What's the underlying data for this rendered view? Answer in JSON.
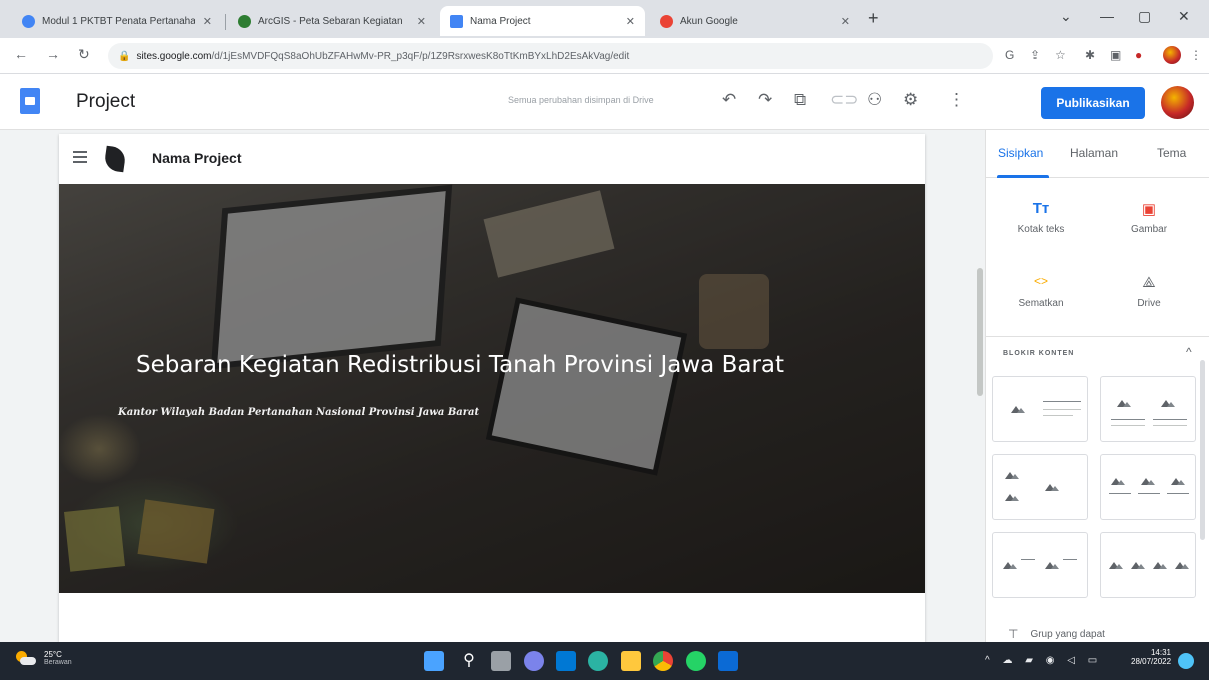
{
  "browser": {
    "tabs": [
      {
        "title": "Modul 1 PKTBT Penata Pertanahan",
        "favicon_color": "#4285f4"
      },
      {
        "title": "ArcGIS - Peta Sebaran Kegiatan",
        "favicon_color": "#2e7d32"
      },
      {
        "title": "Nama Project",
        "favicon_color": "#4285f4",
        "active": true
      },
      {
        "title": "Akun Google",
        "favicon_color": "#ea4335"
      }
    ],
    "new_tab_glyph": "+",
    "url_host": "sites.google.com",
    "url_path": "/d/1jEsMVDFQqS8aOhUbZFAHwMv-PR_p3qF/p/1Z9RsrxwesK8oTtKmBYxLhD2EsAkVag/edit"
  },
  "editor": {
    "doc_title": "Project",
    "save_status": "Semua perubahan disimpan di Drive",
    "publish_label": "Publikasikan",
    "header_icons": [
      "undo-icon",
      "redo-icon",
      "preview-icon",
      "link-icon",
      "share-icon",
      "settings-icon",
      "more-icon"
    ],
    "avatar_color": "#c62828"
  },
  "site": {
    "name": "Nama Project",
    "hero_title": "Sebaran Kegiatan Redistribusi Tanah Provinsi Jawa Barat",
    "hero_subtitle": "Kantor Wilayah Badan Pertanahan Nasional Provinsi Jawa Barat"
  },
  "panel": {
    "tabs": [
      "Sisipkan",
      "Halaman",
      "Tema"
    ],
    "active_tab": "Sisipkan",
    "insert_items": [
      {
        "label": "Kotak teks",
        "icon": "text-box-icon",
        "glyph": "Tт"
      },
      {
        "label": "Gambar",
        "icon": "image-icon",
        "glyph": "▣"
      },
      {
        "label": "Sematkan",
        "icon": "embed-icon",
        "glyph": "<>"
      },
      {
        "label": "Drive",
        "icon": "drive-icon",
        "glyph": "⟁"
      }
    ],
    "section_title": "BLOKIR KONTEN",
    "group_label": "Grup yang dapat",
    "accent": "#1a73e8"
  },
  "taskbar": {
    "temperature": "25°C",
    "weather_text": "Berawan",
    "time": "14:31",
    "date": "28/07/2022"
  }
}
